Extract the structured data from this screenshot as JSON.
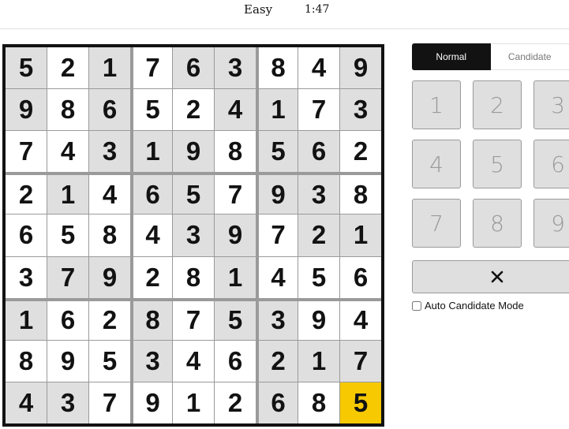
{
  "header": {
    "difficulty": "Easy",
    "timer": "1:47"
  },
  "board": {
    "values": [
      [
        5,
        2,
        1,
        7,
        6,
        3,
        8,
        4,
        9
      ],
      [
        9,
        8,
        6,
        5,
        2,
        4,
        1,
        7,
        3
      ],
      [
        7,
        4,
        3,
        1,
        9,
        8,
        5,
        6,
        2
      ],
      [
        2,
        1,
        4,
        6,
        5,
        7,
        9,
        3,
        8
      ],
      [
        6,
        5,
        8,
        4,
        3,
        9,
        7,
        2,
        1
      ],
      [
        3,
        7,
        9,
        2,
        8,
        1,
        4,
        5,
        6
      ],
      [
        1,
        6,
        2,
        8,
        7,
        5,
        3,
        9,
        4
      ],
      [
        8,
        9,
        5,
        3,
        4,
        6,
        2,
        1,
        7
      ],
      [
        4,
        3,
        7,
        9,
        1,
        2,
        6,
        8,
        5
      ]
    ],
    "shading": [
      [
        1,
        0,
        1,
        0,
        1,
        1,
        0,
        0,
        1
      ],
      [
        1,
        0,
        1,
        0,
        0,
        1,
        1,
        0,
        1
      ],
      [
        0,
        0,
        1,
        1,
        1,
        0,
        1,
        1,
        0
      ],
      [
        0,
        1,
        0,
        1,
        1,
        0,
        1,
        1,
        0
      ],
      [
        0,
        0,
        0,
        0,
        1,
        1,
        0,
        1,
        1
      ],
      [
        0,
        1,
        1,
        0,
        0,
        1,
        0,
        0,
        0
      ],
      [
        1,
        0,
        0,
        1,
        0,
        1,
        1,
        0,
        0
      ],
      [
        0,
        0,
        0,
        1,
        0,
        0,
        1,
        1,
        1
      ],
      [
        1,
        1,
        0,
        0,
        0,
        0,
        1,
        0,
        0
      ]
    ],
    "selected_cell": {
      "row": 9,
      "col": 9
    },
    "colors": {
      "shaded": "#dfdfdf",
      "selected": "#f7c900",
      "border": "#121212",
      "box_divider": "#9a9a9a"
    }
  },
  "controls": {
    "mode_tabs": [
      {
        "label": "Normal",
        "active": true
      },
      {
        "label": "Candidate",
        "active": false
      }
    ],
    "numpad": [
      "1",
      "2",
      "3",
      "4",
      "5",
      "6",
      "7",
      "8",
      "9"
    ],
    "erase_icon": "close-icon",
    "auto_candidate_label": "Auto Candidate Mode",
    "auto_candidate_checked": false
  }
}
